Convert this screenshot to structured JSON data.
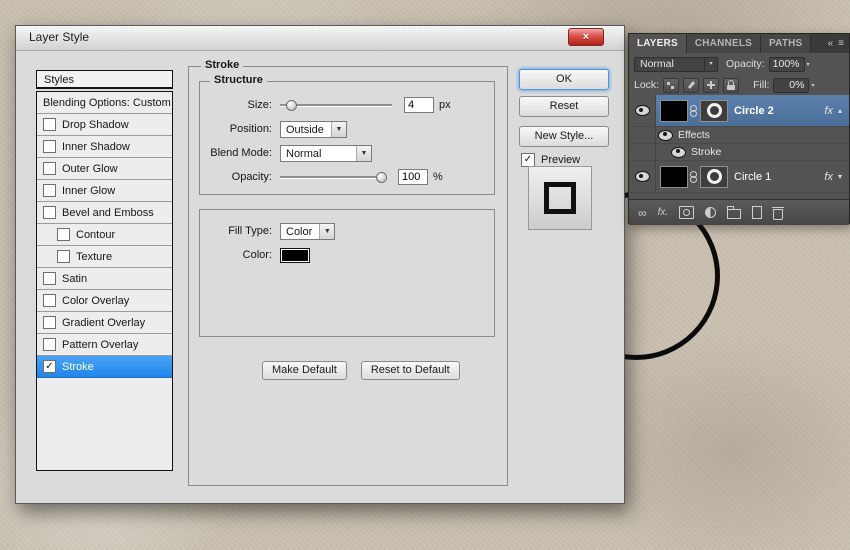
{
  "window": {
    "title": "Layer Style"
  },
  "icons": {
    "close": "×",
    "check": "✓",
    "combo_arrow": "▼",
    "small_arrow": "▾",
    "up_arrow": "▴",
    "spin_arrow": "▾",
    "collapse": "«",
    "panel_menu": "≡",
    "link": "∞",
    "fx_bottom": "fx."
  },
  "styles_panel": {
    "header": "Styles",
    "blending_options": "Blending Options: Custom",
    "items": [
      {
        "label": "Drop Shadow",
        "checked": false
      },
      {
        "label": "Inner Shadow",
        "checked": false
      },
      {
        "label": "Outer Glow",
        "checked": false
      },
      {
        "label": "Inner Glow",
        "checked": false
      },
      {
        "label": "Bevel and Emboss",
        "checked": false
      },
      {
        "label": "Contour",
        "checked": false
      },
      {
        "label": "Texture",
        "checked": false
      },
      {
        "label": "Satin",
        "checked": false
      },
      {
        "label": "Color Overlay",
        "checked": false
      },
      {
        "label": "Gradient Overlay",
        "checked": false
      },
      {
        "label": "Pattern Overlay",
        "checked": false
      },
      {
        "label": "Stroke",
        "checked": true
      }
    ]
  },
  "stroke_panel": {
    "title": "Stroke",
    "structure_legend": "Structure",
    "size_label": "Size:",
    "size_value": "4",
    "size_unit": "px",
    "position_label": "Position:",
    "position_value": "Outside",
    "blend_mode_label": "Blend Mode:",
    "blend_mode_value": "Normal",
    "opacity_label": "Opacity:",
    "opacity_value": "100",
    "opacity_unit": "%",
    "fill_type_label": "Fill Type:",
    "fill_type_value": "Color",
    "color_label": "Color:",
    "make_default_label": "Make Default",
    "reset_to_default_label": "Reset to Default"
  },
  "dialog_actions": {
    "ok": "OK",
    "reset": "Reset",
    "new_style": "New Style...",
    "preview": "Preview"
  },
  "layers_panel": {
    "tabs": [
      {
        "label": "LAYERS"
      },
      {
        "label": "CHANNELS"
      },
      {
        "label": "PATHS"
      }
    ],
    "blend_mode": "Normal",
    "opacity_label": "Opacity:",
    "opacity_value": "100%",
    "lock_label": "Lock:",
    "fill_label": "Fill:",
    "fill_value": "0%",
    "fx_label": "fx",
    "layers": [
      {
        "name": "Circle 2",
        "selected": true
      },
      {
        "name": "Effects"
      },
      {
        "name": "Stroke"
      },
      {
        "name": "Circle 1",
        "selected": false
      }
    ]
  }
}
